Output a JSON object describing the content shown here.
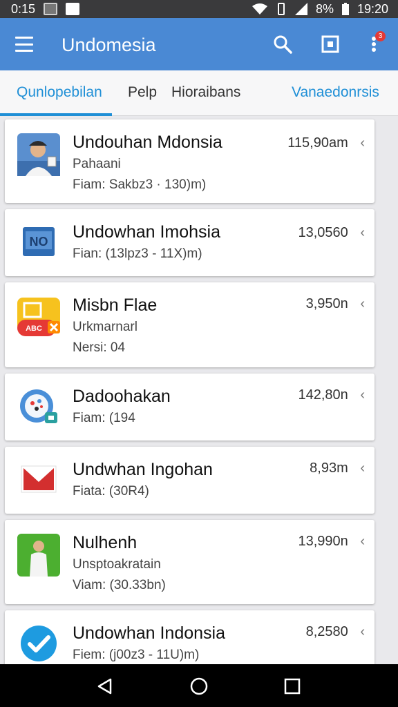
{
  "status_bar": {
    "time_left": "0:15",
    "battery_text": "8%",
    "time_right": "19:20"
  },
  "app_bar": {
    "title": "Undomesia",
    "notification_count": "3"
  },
  "tabs": [
    {
      "label": "Qunlopebilan"
    },
    {
      "label": "Pelp"
    },
    {
      "label": "Hioraibans"
    },
    {
      "label": "Vanaedonrsis"
    }
  ],
  "items": [
    {
      "title": "Undouhan Mdonsia",
      "line1": "Pahaani",
      "line2": "Fiam: Sakbz3 · 130)m)",
      "value": "115,90am",
      "icon": "portrait-icon"
    },
    {
      "title": "Undowhan Imohsia",
      "line1": "Fian: (13lpz3 - 11X)m)",
      "line2": "",
      "value": "13,0560",
      "icon": "news-icon"
    },
    {
      "title": "Misbn Flae",
      "line1": "Urkmarnarl",
      "line2": "Nersi: 04",
      "value": "3,950n",
      "icon": "folder-icon"
    },
    {
      "title": "Dadoohakan",
      "line1": "Fiam: (194",
      "line2": "",
      "value": "142,80n",
      "icon": "globe-icon"
    },
    {
      "title": "Undwhan Ingohan",
      "line1": "Fiata: (30R4)",
      "line2": "",
      "value": "8,93m",
      "icon": "mail-icon"
    },
    {
      "title": "Nulhenh",
      "line1": "Unsptoakratain",
      "line2": "Viam: (30.33bn)",
      "value": "13,990n",
      "icon": "person-icon"
    },
    {
      "title": "Undowhan Indonsia",
      "line1": "Fiem: (j00z3 - 11U)m)",
      "line2": "",
      "value": "8,2580",
      "icon": "check-icon"
    }
  ],
  "colors": {
    "app_bar": "#4a89d4",
    "accent": "#1f8fd6",
    "badge": "#e53935"
  }
}
